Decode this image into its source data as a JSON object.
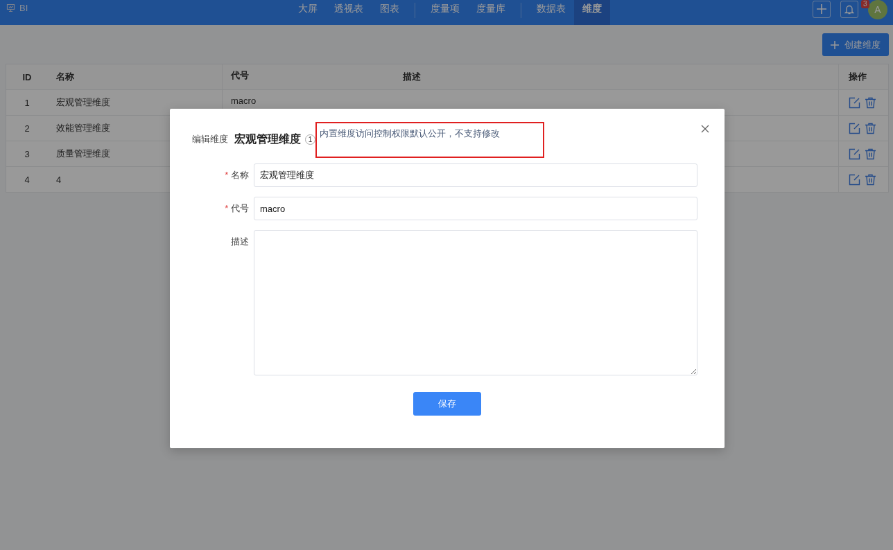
{
  "app": {
    "title": "BI"
  },
  "nav_groups": [
    [
      {
        "label": "大屏",
        "selected": false
      },
      {
        "label": "透视表",
        "selected": false
      },
      {
        "label": "图表",
        "selected": false
      }
    ],
    [
      {
        "label": "度量项",
        "selected": false
      },
      {
        "label": "度量库",
        "selected": false
      }
    ],
    [
      {
        "label": "数据表",
        "selected": false
      },
      {
        "label": "维度",
        "selected": true
      }
    ]
  ],
  "notifications": {
    "count": "3"
  },
  "avatar": {
    "letter": "A"
  },
  "create_button": {
    "label": "创建维度"
  },
  "table": {
    "columns": [
      "ID",
      "名称",
      "代号",
      "描述",
      "操作"
    ],
    "rows": [
      {
        "id": "1",
        "name": "宏观管理维度",
        "code": "macro"
      },
      {
        "id": "2",
        "name": "效能管理维度"
      },
      {
        "id": "3",
        "name": "质量管理维度"
      },
      {
        "id": "4",
        "name": "4"
      }
    ]
  },
  "dialog": {
    "title_prefix": "编辑维度",
    "title": "宏观管理维度",
    "tip_number": "1",
    "tip": "内置维度访问控制权限默认公开，不支持修改",
    "tip_highlighted": true,
    "fields": [
      {
        "label": "名称",
        "required": true,
        "kind": "input",
        "value": "宏观管理维度"
      },
      {
        "label": "代号",
        "required": true,
        "kind": "input",
        "value": "macro"
      },
      {
        "label": "描述",
        "required": false,
        "kind": "textarea"
      }
    ],
    "required_mark": "*",
    "save_button": "保存"
  }
}
